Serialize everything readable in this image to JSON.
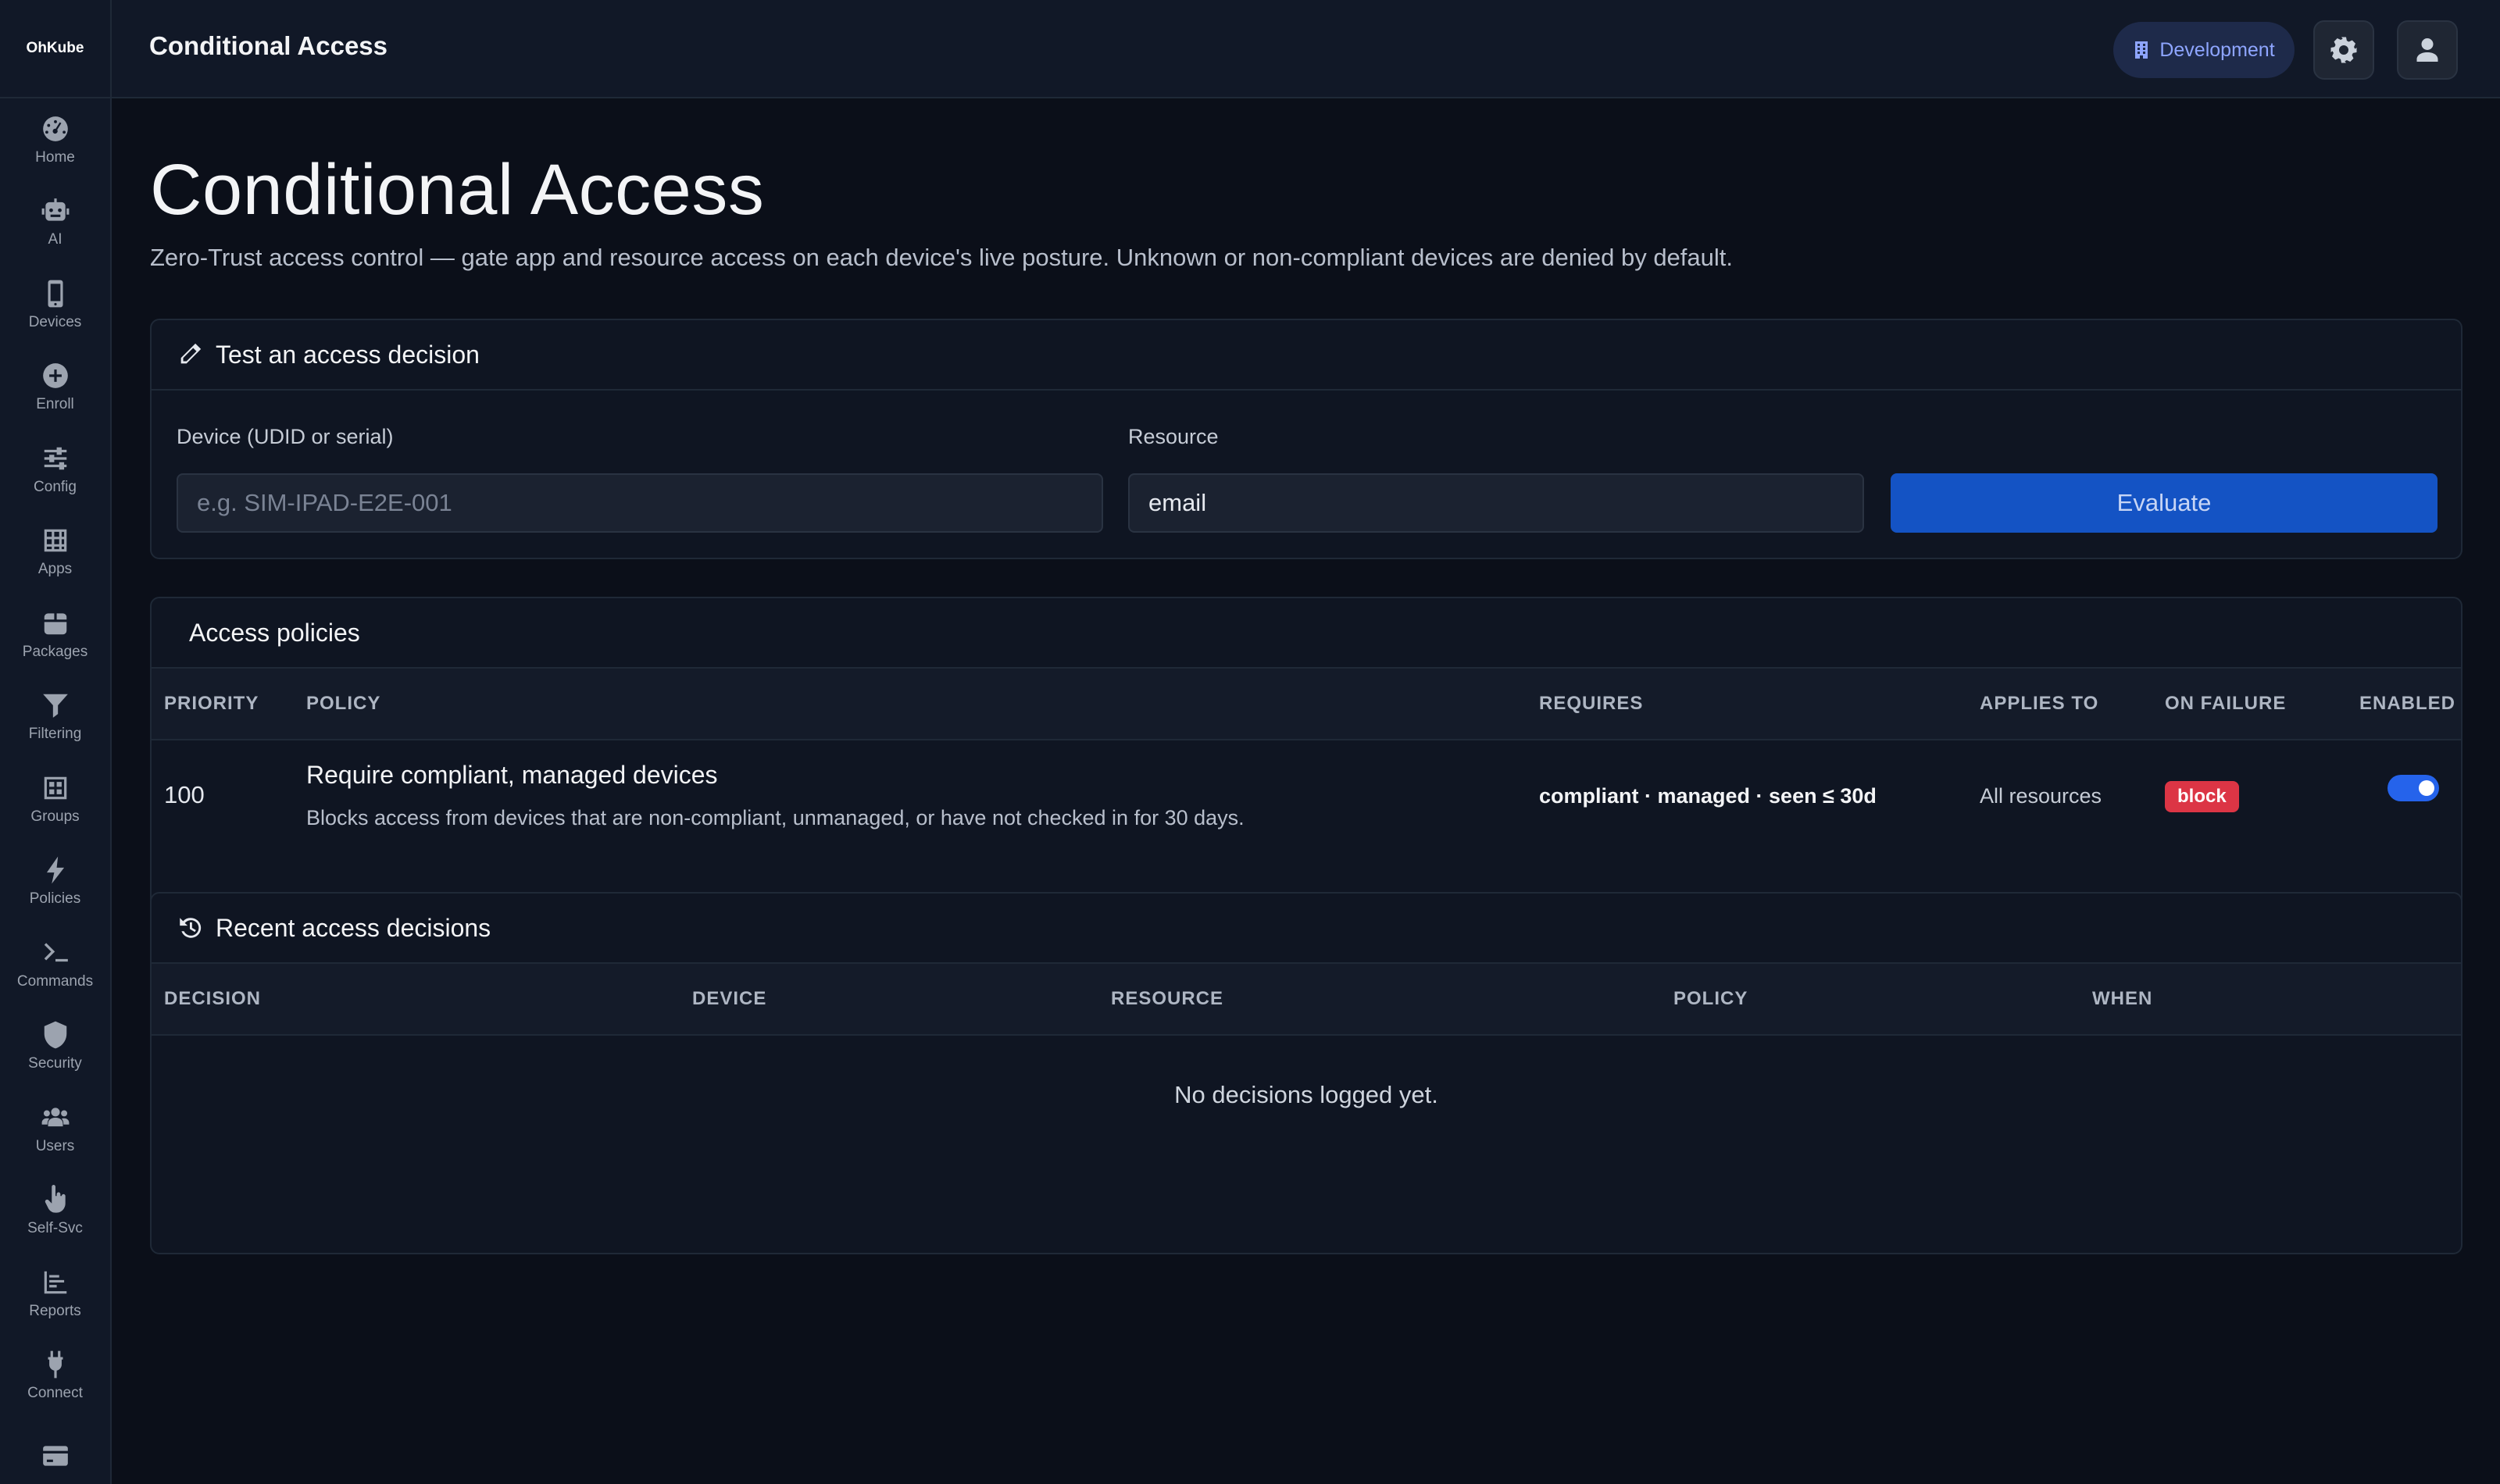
{
  "brand": "OhKube",
  "nav": [
    {
      "label": "Home",
      "icon": "gauge-icon"
    },
    {
      "label": "AI",
      "icon": "robot-icon"
    },
    {
      "label": "Devices",
      "icon": "mobile-icon"
    },
    {
      "label": "Enroll",
      "icon": "plus-circle-icon"
    },
    {
      "label": "Config",
      "icon": "sliders-icon"
    },
    {
      "label": "Apps",
      "icon": "grid-icon"
    },
    {
      "label": "Packages",
      "icon": "box-icon"
    },
    {
      "label": "Filtering",
      "icon": "filter-icon"
    },
    {
      "label": "Groups",
      "icon": "groups-icon"
    },
    {
      "label": "Policies",
      "icon": "bolt-icon"
    },
    {
      "label": "Commands",
      "icon": "terminal-icon"
    },
    {
      "label": "Security",
      "icon": "shield-icon"
    },
    {
      "label": "Users",
      "icon": "users-icon"
    },
    {
      "label": "Self-Svc",
      "icon": "hand-pointer-icon"
    },
    {
      "label": "Reports",
      "icon": "chart-icon"
    },
    {
      "label": "Connect",
      "icon": "plug-icon"
    },
    {
      "label": "",
      "icon": "card-icon"
    }
  ],
  "topbar": {
    "title": "Conditional Access",
    "environment": "Development"
  },
  "page": {
    "title": "Conditional Access",
    "subtitle": "Zero-Trust access control — gate app and resource access on each device's live posture. Unknown or non-compliant devices are denied by default."
  },
  "test": {
    "header": "Test an access decision",
    "device_label": "Device (UDID or serial)",
    "device_placeholder": "e.g. SIM-IPAD-E2E-001",
    "resource_label": "Resource",
    "resource_value": "email",
    "evaluate_label": "Evaluate"
  },
  "policies": {
    "header": "Access policies",
    "columns": {
      "priority": "PRIORITY",
      "policy": "POLICY",
      "requires": "REQUIRES",
      "applies_to": "APPLIES TO",
      "on_failure": "ON FAILURE",
      "enabled": "ENABLED"
    },
    "rows": [
      {
        "priority": "100",
        "name": "Require compliant, managed devices",
        "description": "Blocks access from devices that are non-compliant, unmanaged, or have not checked in for 30 days.",
        "requires": "compliant · managed · seen ≤ 30d",
        "applies_to": "All resources",
        "on_failure": "block",
        "enabled": true
      }
    ]
  },
  "recent": {
    "header": "Recent access decisions",
    "columns": {
      "decision": "DECISION",
      "device": "DEVICE",
      "resource": "RESOURCE",
      "policy": "POLICY",
      "when": "WHEN"
    },
    "empty": "No decisions logged yet."
  },
  "colors": {
    "background": "#0b0f19",
    "accent": "#1453c4",
    "danger": "#dc3545",
    "env_text": "#8ea5ff"
  }
}
